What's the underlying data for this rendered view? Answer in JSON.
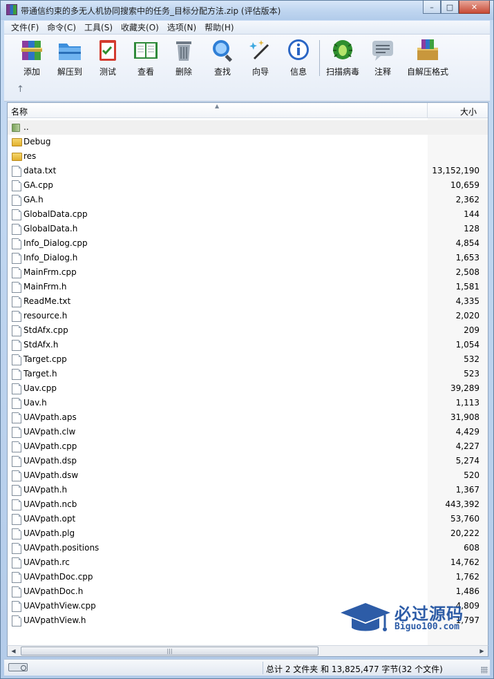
{
  "window": {
    "title": "带通信约束的多无人机协同搜索中的任务_目标分配方法.zip (评估版本)",
    "min": "–",
    "max": "□",
    "close": "✕"
  },
  "menu": [
    "文件(F)",
    "命令(C)",
    "工具(S)",
    "收藏夹(O)",
    "选项(N)",
    "帮助(H)"
  ],
  "toolbar": {
    "add": "添加",
    "extract": "解压到",
    "test": "测试",
    "view": "查看",
    "delete": "删除",
    "find": "查找",
    "wizard": "向导",
    "info": "信息",
    "scan": "扫描病毒",
    "comment": "注释",
    "sfx": "自解压格式",
    "up": "↑"
  },
  "columns": {
    "name": "名称",
    "size": "大小"
  },
  "files": [
    {
      "name": "..",
      "size": "",
      "type": "updir"
    },
    {
      "name": "Debug",
      "size": "",
      "type": "folder"
    },
    {
      "name": "res",
      "size": "",
      "type": "folder"
    },
    {
      "name": "data.txt",
      "size": "13,152,190",
      "type": "file"
    },
    {
      "name": "GA.cpp",
      "size": "10,659",
      "type": "file"
    },
    {
      "name": "GA.h",
      "size": "2,362",
      "type": "file"
    },
    {
      "name": "GlobalData.cpp",
      "size": "144",
      "type": "file"
    },
    {
      "name": "GlobalData.h",
      "size": "128",
      "type": "file"
    },
    {
      "name": "Info_Dialog.cpp",
      "size": "4,854",
      "type": "file"
    },
    {
      "name": "Info_Dialog.h",
      "size": "1,653",
      "type": "file"
    },
    {
      "name": "MainFrm.cpp",
      "size": "2,508",
      "type": "file"
    },
    {
      "name": "MainFrm.h",
      "size": "1,581",
      "type": "file"
    },
    {
      "name": "ReadMe.txt",
      "size": "4,335",
      "type": "file"
    },
    {
      "name": "resource.h",
      "size": "2,020",
      "type": "file"
    },
    {
      "name": "StdAfx.cpp",
      "size": "209",
      "type": "file"
    },
    {
      "name": "StdAfx.h",
      "size": "1,054",
      "type": "file"
    },
    {
      "name": "Target.cpp",
      "size": "532",
      "type": "file"
    },
    {
      "name": "Target.h",
      "size": "523",
      "type": "file"
    },
    {
      "name": "Uav.cpp",
      "size": "39,289",
      "type": "file"
    },
    {
      "name": "Uav.h",
      "size": "1,113",
      "type": "file"
    },
    {
      "name": "UAVpath.aps",
      "size": "31,908",
      "type": "file"
    },
    {
      "name": "UAVpath.clw",
      "size": "4,429",
      "type": "file"
    },
    {
      "name": "UAVpath.cpp",
      "size": "4,227",
      "type": "file"
    },
    {
      "name": "UAVpath.dsp",
      "size": "5,274",
      "type": "file"
    },
    {
      "name": "UAVpath.dsw",
      "size": "520",
      "type": "file"
    },
    {
      "name": "UAVpath.h",
      "size": "1,367",
      "type": "file"
    },
    {
      "name": "UAVpath.ncb",
      "size": "443,392",
      "type": "file"
    },
    {
      "name": "UAVpath.opt",
      "size": "53,760",
      "type": "file"
    },
    {
      "name": "UAVpath.plg",
      "size": "20,222",
      "type": "file"
    },
    {
      "name": "UAVpath.positions",
      "size": "608",
      "type": "file"
    },
    {
      "name": "UAVpath.rc",
      "size": "14,762",
      "type": "file"
    },
    {
      "name": "UAVpathDoc.cpp",
      "size": "1,762",
      "type": "file"
    },
    {
      "name": "UAVpathDoc.h",
      "size": "1,486",
      "type": "file"
    },
    {
      "name": "UAVpathView.cpp",
      "size": "4,809",
      "type": "file"
    },
    {
      "name": "UAVpathView.h",
      "size": "1,797",
      "type": "file"
    }
  ],
  "status": {
    "summary": "总计 2 文件夹 和 13,825,477 字节(32 个文件)"
  },
  "watermark": {
    "main": "必过源码",
    "sub": "Biguo100.com"
  },
  "colors": {
    "accent": "#1c4fa0",
    "folder": "#e2b02e"
  }
}
